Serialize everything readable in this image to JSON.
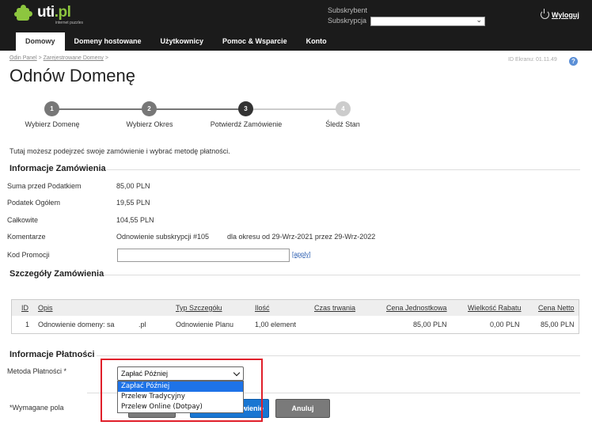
{
  "header": {
    "logo_text": "uti",
    "logo_ext": ".pl",
    "logo_tagline": "internet puzzles",
    "subscriber_label": "Subskrybent",
    "subscription_label": "Subskrypcja",
    "subscription_value": "",
    "logout_label": "Wyloguj"
  },
  "nav": {
    "items": [
      {
        "label": "Domowy"
      },
      {
        "label": "Domeny hostowane"
      },
      {
        "label": "Użytkownicy"
      },
      {
        "label": "Pomoc & Wsparcie"
      },
      {
        "label": "Konto"
      }
    ]
  },
  "page": {
    "breadcrumb": [
      "Odin Panel",
      "Zarejestrowane Domeny"
    ],
    "breadcrumb_sep": ">",
    "screen_id": "ID Ekranu: 01.11.49",
    "help": "?",
    "title": "Odnów Domenę",
    "intro": "Tutaj możesz podejrzeć swoje zamówienie i wybrać metodę płatności."
  },
  "steps": [
    {
      "number": "1",
      "label": "Wybierz Domenę",
      "state": "done"
    },
    {
      "number": "2",
      "label": "Wybierz Okres",
      "state": "done"
    },
    {
      "number": "3",
      "label": "Potwierdź Zamówienie",
      "state": "current"
    },
    {
      "number": "4",
      "label": "Śledź Stan",
      "state": "todo"
    }
  ],
  "order_info": {
    "title": "Informacje Zamówienia",
    "subtotal_label": "Suma przed Podatkiem",
    "subtotal_value": "85,00 PLN",
    "tax_label": "Podatek Ogółem",
    "tax_value": "19,55 PLN",
    "total_label": "Całkowite",
    "total_value": "104,55 PLN",
    "comment_label": "Komentarze",
    "comment_value": "Odnowienie subskrypcji #105",
    "comment_period": "dla okresu od 29-Wrz-2021 przez 29-Wrz-2022",
    "promo_label": "Kod Promocji",
    "promo_value": "",
    "apply_label": "[apply]"
  },
  "details": {
    "title": "Szczegóły Zamówienia",
    "columns": {
      "id": "ID",
      "desc": "Opis",
      "type": "Typ Szczegółu",
      "qty": "Ilość",
      "duration": "Czas trwania",
      "unit_price": "Cena Jednostkowa",
      "discount": "Wielkość Rabatu",
      "net": "Cena Netto"
    },
    "rows": [
      {
        "id": "1",
        "desc": "Odnowienie domeny: sa",
        "desc_ext": ".pl",
        "type": "Odnowienie Planu",
        "qty": "1,00 element",
        "duration": "",
        "unit_price": "85,00 PLN",
        "discount": "0,00 PLN",
        "net": "85,00 PLN"
      }
    ]
  },
  "payment": {
    "title": "Informacje Płatności",
    "method_label": "Metoda Płatności *",
    "selected": "Zapłać Później",
    "options": [
      "Zapłać Później",
      "Przelew Tradycyjny",
      "Przelew Online (Dotpay)"
    ]
  },
  "footer": {
    "required_note": "*Wymagane pola",
    "confirm_label": "wienie",
    "cancel_label": "Anuluj"
  },
  "colors": {
    "header_bg": "#1b1b1b",
    "accent_green": "#8dc63f",
    "step_done": "#777777",
    "step_current": "#333333",
    "step_todo": "#cccccc",
    "highlight": "#e01f2a",
    "select_blue": "#1e73e8"
  }
}
